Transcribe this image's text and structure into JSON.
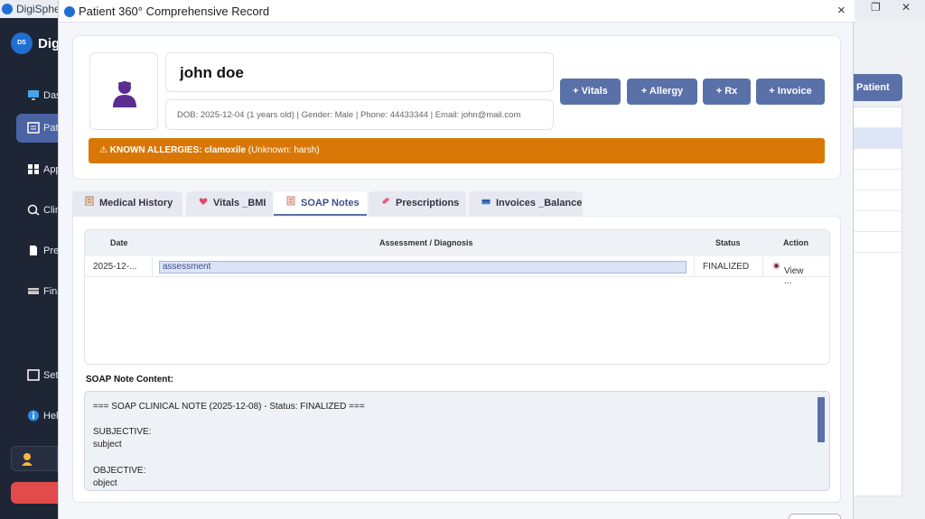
{
  "background": {
    "app_title": "DigiSphe",
    "brand_text": "Dig",
    "brand_logo_text": "DS",
    "nav": [
      {
        "label": "Das",
        "icon": "monitor-icon"
      },
      {
        "label": "Pati",
        "icon": "patient-card-icon"
      },
      {
        "label": "App",
        "icon": "grid-icon"
      },
      {
        "label": "Clin",
        "icon": "clinic-icon"
      },
      {
        "label": "Pre",
        "icon": "document-icon"
      },
      {
        "label": "Fina",
        "icon": "card-icon"
      },
      {
        "label": "Set",
        "icon": "settings-icon"
      },
      {
        "label": "Hel",
        "icon": "info-icon"
      }
    ],
    "add_patient_label": "Patient"
  },
  "modal": {
    "title": "Patient 360° Comprehensive Record",
    "close_symbol": "×",
    "patient": {
      "name": "john doe",
      "meta": "DOB: 2025-12-04 (1 years old)  |  Gender: Male  |  Phone: 44433344  |  Email: john@mail.com"
    },
    "quick_actions": [
      "+ Vitals",
      "+ Allergy",
      "+ Rx",
      "+ Invoice"
    ],
    "allergy": {
      "icon": "⚠",
      "label": "KNOWN ALLERGIES: clamoxile",
      "detail": "(Unknown: harsh)"
    },
    "tabs": [
      {
        "label": "Medical History",
        "icon": "clipboard-icon"
      },
      {
        "label": "Vitals _BMI",
        "icon": "heart-icon"
      },
      {
        "label": "SOAP Notes",
        "icon": "notes-icon"
      },
      {
        "label": "Prescriptions",
        "icon": "pill-icon"
      },
      {
        "label": "Invoices _Balance",
        "icon": "invoice-icon"
      }
    ],
    "soap_table": {
      "headers": [
        "Date",
        "Assessment / Diagnosis",
        "Status",
        "Action"
      ],
      "rows": [
        {
          "date": "2025-12-...",
          "assessment": "assessment",
          "status": "FINALIZED",
          "action": "View ..."
        }
      ]
    },
    "soap_content_label": "SOAP Note Content:",
    "soap_content_lines": [
      "=== SOAP CLINICAL NOTE (2025-12-08) - Status: FINALIZED ===",
      "",
      "SUBJECTIVE:",
      "subject",
      "",
      "OBJECTIVE:",
      "object"
    ]
  },
  "colors": {
    "accent": "#5a70a8",
    "warning": "#d97706",
    "sidebar": "#1e2535"
  }
}
